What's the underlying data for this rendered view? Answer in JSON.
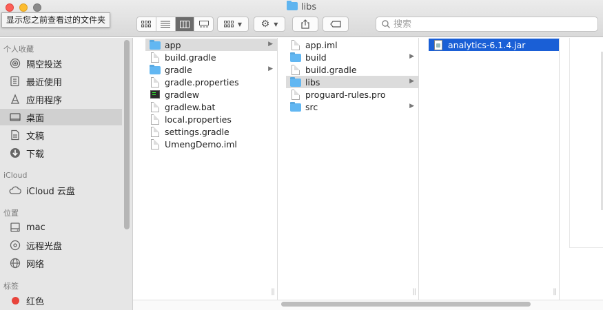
{
  "window": {
    "title": "libs"
  },
  "tooltip": "显示您之前查看过的文件夹",
  "search": {
    "placeholder": "搜索"
  },
  "sidebar": {
    "sections": [
      {
        "title": "个人收藏",
        "items": [
          {
            "label": "隔空投送",
            "icon": "airdrop-icon"
          },
          {
            "label": "最近使用",
            "icon": "recents-icon"
          },
          {
            "label": "应用程序",
            "icon": "applications-icon"
          },
          {
            "label": "桌面",
            "icon": "desktop-icon",
            "selected": true
          },
          {
            "label": "文稿",
            "icon": "documents-icon"
          },
          {
            "label": "下载",
            "icon": "downloads-icon"
          }
        ]
      },
      {
        "title": "iCloud",
        "items": [
          {
            "label": "iCloud 云盘",
            "icon": "icloud-icon"
          }
        ]
      },
      {
        "title": "位置",
        "items": [
          {
            "label": "mac",
            "icon": "hard-drive-icon"
          },
          {
            "label": "远程光盘",
            "icon": "remote-disc-icon"
          },
          {
            "label": "网络",
            "icon": "network-icon"
          }
        ]
      },
      {
        "title": "标签",
        "items": [
          {
            "label": "红色",
            "icon": "red-tag-icon",
            "color": "#e8443b"
          }
        ]
      }
    ]
  },
  "columns": [
    {
      "items": [
        {
          "name": "app",
          "type": "folder",
          "has_children": true,
          "selected": "gray"
        },
        {
          "name": "build.gradle",
          "type": "file"
        },
        {
          "name": "gradle",
          "type": "folder",
          "has_children": true
        },
        {
          "name": "gradle.properties",
          "type": "file"
        },
        {
          "name": "gradlew",
          "type": "exec"
        },
        {
          "name": "gradlew.bat",
          "type": "file"
        },
        {
          "name": "local.properties",
          "type": "file"
        },
        {
          "name": "settings.gradle",
          "type": "file"
        },
        {
          "name": "UmengDemo.iml",
          "type": "file"
        }
      ]
    },
    {
      "items": [
        {
          "name": "app.iml",
          "type": "file"
        },
        {
          "name": "build",
          "type": "folder",
          "has_children": true
        },
        {
          "name": "build.gradle",
          "type": "file"
        },
        {
          "name": "libs",
          "type": "folder",
          "has_children": true,
          "selected": "gray"
        },
        {
          "name": "proguard-rules.pro",
          "type": "file"
        },
        {
          "name": "src",
          "type": "folder",
          "has_children": true
        }
      ]
    },
    {
      "items": [
        {
          "name": "analytics-6.1.4.jar",
          "type": "jar",
          "selected": "blue"
        }
      ]
    }
  ]
}
